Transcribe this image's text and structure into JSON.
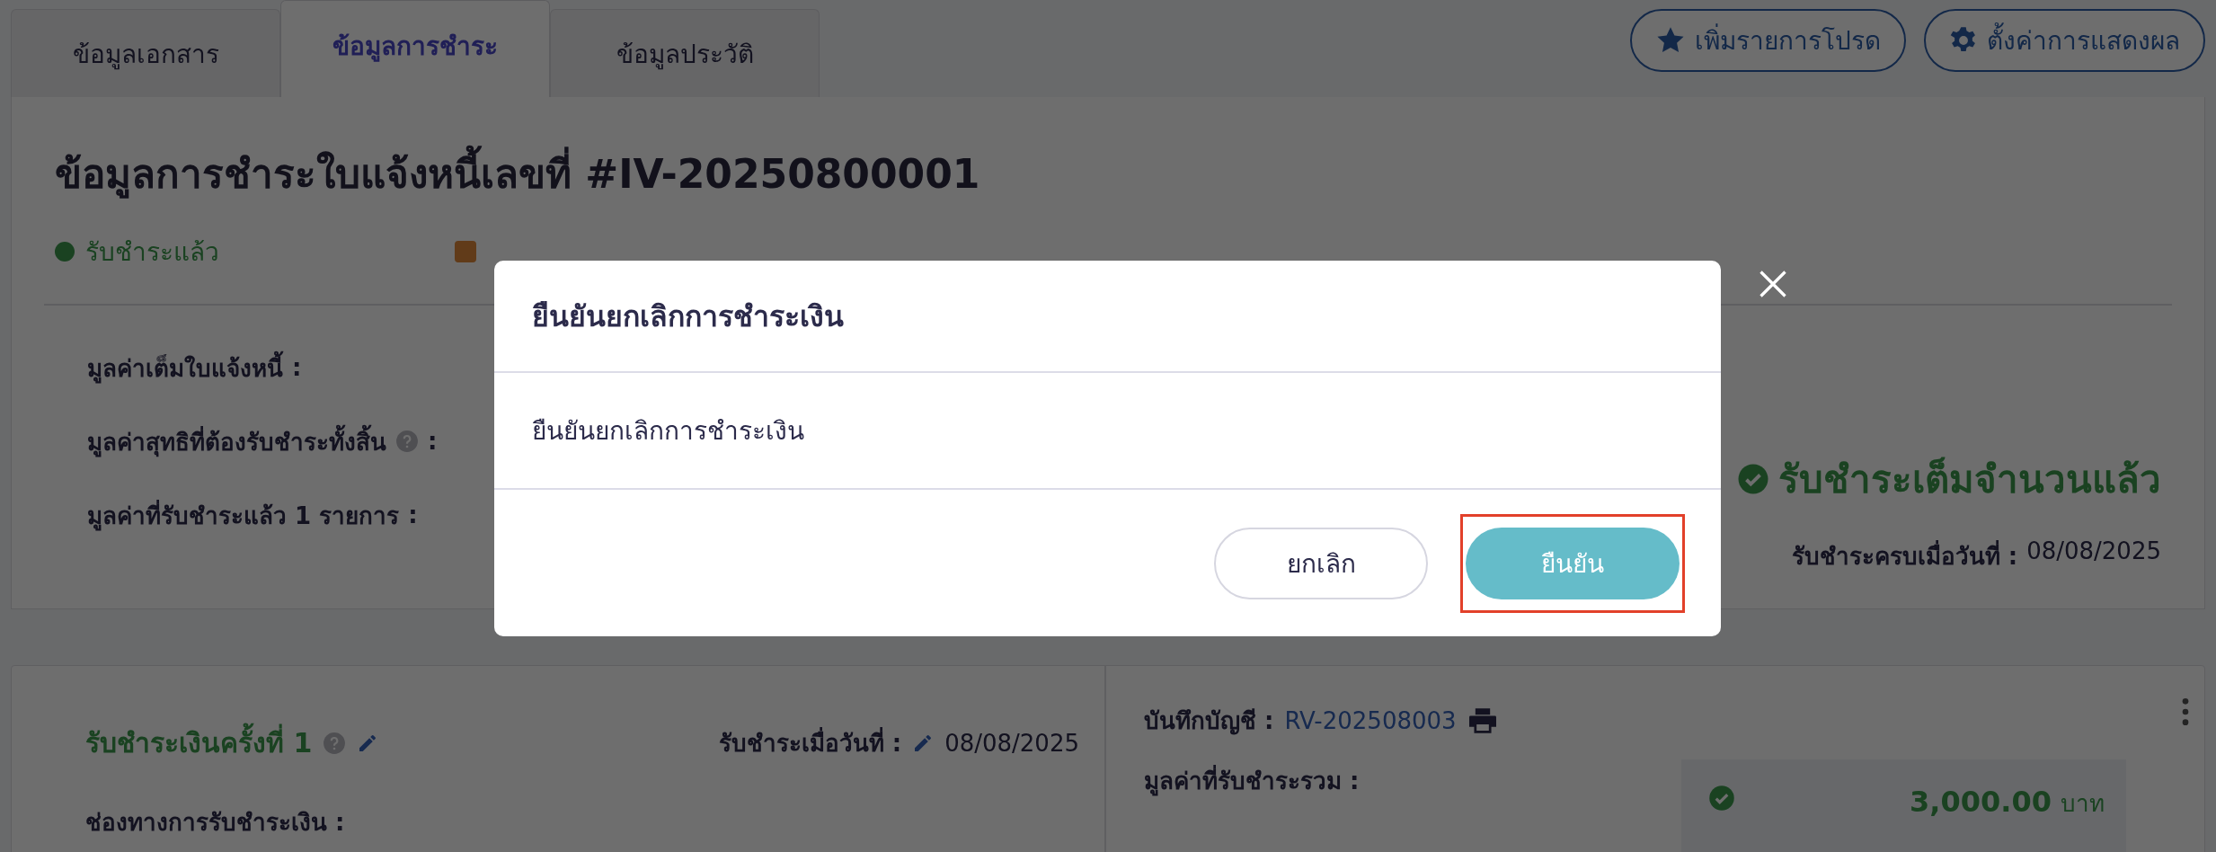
{
  "tabs": [
    {
      "label": "ข้อมูลเอกสาร",
      "selected": false
    },
    {
      "label": "ข้อมูลการชำระ",
      "selected": true
    },
    {
      "label": "ข้อมูลประวัติ",
      "selected": false
    }
  ],
  "toolbar": [
    {
      "label": "เพิ่มรายการโปรด",
      "kind": "star"
    },
    {
      "label": "ตั้งค่าการแสดงผล",
      "kind": "gear"
    }
  ],
  "summary": {
    "title": "ข้อมูลการชำระใบแจ้งหนี้เลขที่ #IV-20250800001",
    "status": "รับชำระแล้ว",
    "fields": [
      {
        "label": "มูลค่าเต็มใบแจ้งหนี้",
        "help": false,
        "colon": ":"
      },
      {
        "label": "มูลค่าสุทธิที่ต้องรับชำระทั้งสิ้น",
        "help": true,
        "colon": ":"
      },
      {
        "label": "มูลค่าที่รับชำระแล้ว 1 รายการ",
        "help": false,
        "colon": ":"
      }
    ],
    "paid_state": "รับชำระเต็มจำนวนแล้ว",
    "paid_date_label": "รับชำระครบเมื่อวันที่ :",
    "paid_date": "08/08/2025"
  },
  "payment": {
    "title": "รับชำระเงินครั้งที่ 1",
    "date_label": "รับชำระเมื่อวันที่ :",
    "date": "08/08/2025",
    "channel_label": "ช่องทางการรับชำระเงิน :",
    "account_label": "บันทึกบัญชี :",
    "account_link": "RV-202508003",
    "total_label": "มูลค่าที่รับชำระรวม :",
    "amount": "3,000.00",
    "currency": "บาท"
  },
  "dialog": {
    "title": "ยืนยันยกเลิกการชำระเงิน",
    "message": "ยืนยันยกเลิกการชำระเงิน",
    "buttons": [
      {
        "label": "ยกเลิก",
        "kind": "secondary",
        "highlighted": false
      },
      {
        "label": "ยืนยัน",
        "kind": "primary",
        "highlighted": true
      }
    ]
  }
}
